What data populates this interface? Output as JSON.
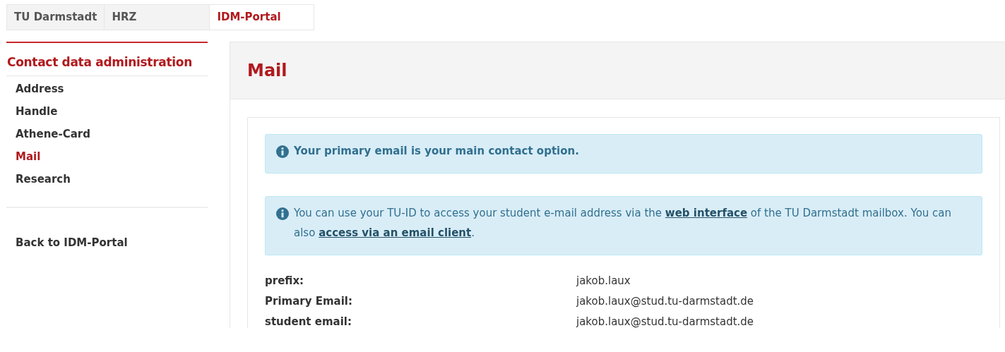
{
  "breadcrumbs": [
    {
      "label": "TU Darmstadt",
      "selected": false
    },
    {
      "label": "HRZ",
      "selected": false
    },
    {
      "label": "IDM-Portal",
      "selected": true
    }
  ],
  "sidebar": {
    "title": "Contact data administration",
    "items": [
      {
        "label": "Address",
        "selected": false
      },
      {
        "label": "Handle",
        "selected": false
      },
      {
        "label": "Athene-Card",
        "selected": false
      },
      {
        "label": "Mail",
        "selected": true
      },
      {
        "label": "Research",
        "selected": false
      }
    ],
    "back_link": "Back to IDM-Portal"
  },
  "page_title": "Mail",
  "alerts": [
    {
      "kind": "bold",
      "segments": [
        {
          "kind": "text",
          "text": "Your primary email is your main contact option."
        }
      ]
    },
    {
      "kind": "plain",
      "segments": [
        {
          "kind": "text",
          "text": "You can use your TU-ID to access your student e-mail address via the "
        },
        {
          "kind": "link",
          "text": "web interface"
        },
        {
          "kind": "text",
          "text": " of the TU Darmstadt mailbox. You can also "
        },
        {
          "kind": "link",
          "text": "access via an email client"
        },
        {
          "kind": "text",
          "text": "."
        }
      ]
    }
  ],
  "fields": [
    {
      "label": "prefix:",
      "value": "jakob.laux"
    },
    {
      "label": "Primary Email:",
      "value": "jakob.laux@stud.tu-darmstadt.de"
    },
    {
      "label": "student email:",
      "value": "jakob.laux@stud.tu-darmstadt.de"
    }
  ]
}
